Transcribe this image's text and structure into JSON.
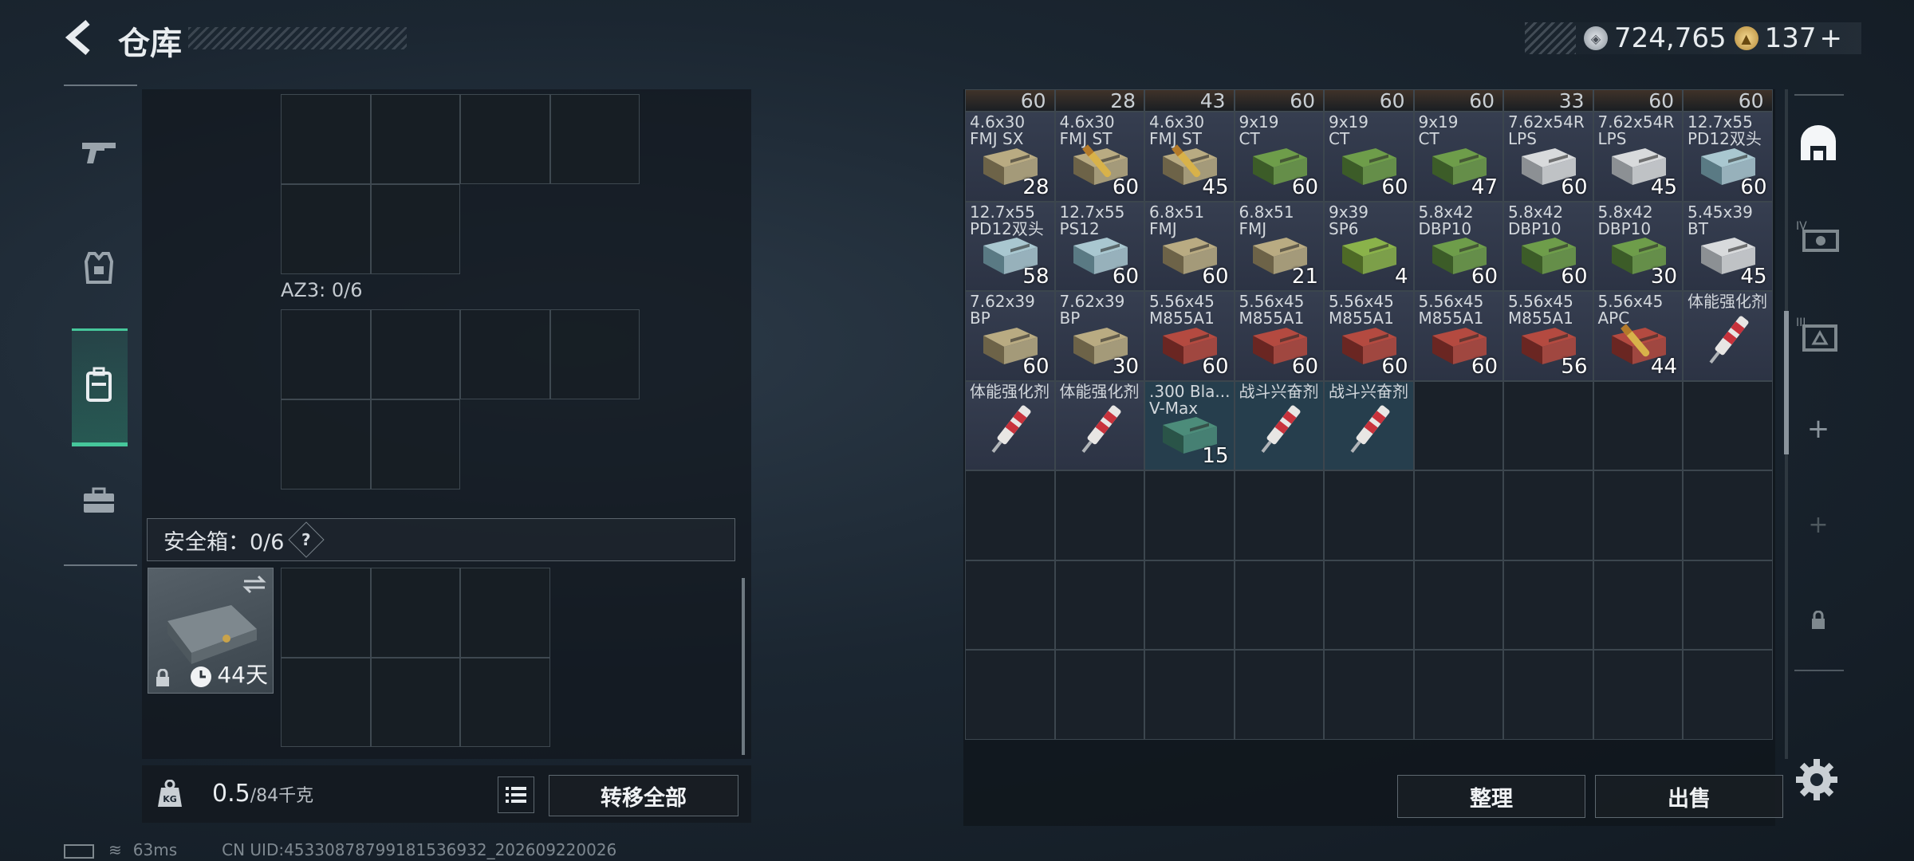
{
  "header": {
    "title": "仓库"
  },
  "currency": {
    "silver": "724,765",
    "gold": "137",
    "gold_add": "+"
  },
  "left": {
    "az_label": "AZ3: 0/6",
    "safebox_label": "安全箱：0/6",
    "help": "?",
    "safebox_timer": "44天",
    "weight_current": "0.5",
    "weight_max": "/84千克",
    "transfer_all": "转移全部"
  },
  "status": {
    "ping": "63ms",
    "uid": "CN UID:4533087879918153693​2_202609220026"
  },
  "stash": {
    "top_counts": [
      "60",
      "28",
      "43",
      "60",
      "60",
      "60",
      "33",
      "60",
      "60"
    ],
    "rows": [
      [
        {
          "l": "4.6x30\nFMJ SX",
          "q": "28",
          "t": "box-tan"
        },
        {
          "l": "4.6x30\nFMJ ST",
          "q": "60",
          "t": "box-tan-gold"
        },
        {
          "l": "4.6x30\nFMJ ST",
          "q": "45",
          "t": "box-tan-gold"
        },
        {
          "l": "9x19\nCT",
          "q": "60",
          "t": "box-green"
        },
        {
          "l": "9x19\nCT",
          "q": "60",
          "t": "box-green"
        },
        {
          "l": "9x19\nCT",
          "q": "47",
          "t": "box-green"
        },
        {
          "l": "7.62x54R\nLPS",
          "q": "60",
          "t": "box-white"
        },
        {
          "l": "7.62x54R\nLPS",
          "q": "45",
          "t": "box-white"
        },
        {
          "l": "12.7x55\nPD12双头",
          "q": "60",
          "t": "box-blue"
        }
      ],
      [
        {
          "l": "12.7x55\nPD12双头",
          "q": "58",
          "t": "box-blue"
        },
        {
          "l": "12.7x55\nPS12",
          "q": "60",
          "t": "box-blue"
        },
        {
          "l": "6.8x51\nFMJ",
          "q": "60",
          "t": "box-tan"
        },
        {
          "l": "6.8x51\nFMJ",
          "q": "21",
          "t": "box-tan"
        },
        {
          "l": "9x39\nSP6",
          "q": "4",
          "t": "box-lime"
        },
        {
          "l": "5.8x42\nDBP10",
          "q": "60",
          "t": "box-green"
        },
        {
          "l": "5.8x42\nDBP10",
          "q": "60",
          "t": "box-green"
        },
        {
          "l": "5.8x42\nDBP10",
          "q": "30",
          "t": "box-green"
        },
        {
          "l": "5.45x39\nBT",
          "q": "45",
          "t": "box-white"
        }
      ],
      [
        {
          "l": "7.62x39\nBP",
          "q": "60",
          "t": "box-tan"
        },
        {
          "l": "7.62x39\nBP",
          "q": "30",
          "t": "box-tan"
        },
        {
          "l": "5.56x45\nM855A1",
          "q": "60",
          "t": "box-red"
        },
        {
          "l": "5.56x45\nM855A1",
          "q": "60",
          "t": "box-red"
        },
        {
          "l": "5.56x45\nM855A1",
          "q": "60",
          "t": "box-red"
        },
        {
          "l": "5.56x45\nM855A1",
          "q": "60",
          "t": "box-red"
        },
        {
          "l": "5.56x45\nM855A1",
          "q": "56",
          "t": "box-red"
        },
        {
          "l": "5.56x45\nAPC",
          "q": "44",
          "t": "box-red-gold"
        },
        {
          "l": "体能强化剂",
          "q": "",
          "t": "syringe"
        }
      ],
      [
        {
          "l": "体能强化剂",
          "q": "",
          "t": "syringe"
        },
        {
          "l": "体能强化剂",
          "q": "",
          "t": "syringe"
        },
        {
          "l": ".300 Bla...\nV-Max",
          "q": "15",
          "t": "box-teal",
          "hl": true
        },
        {
          "l": "战斗兴奋剂",
          "q": "",
          "t": "syringe",
          "hl": true
        },
        {
          "l": "战斗兴奋剂",
          "q": "",
          "t": "syringe",
          "hl": true
        },
        {},
        {},
        {},
        {}
      ]
    ],
    "empty_rows": 3,
    "sort_button": "整理",
    "sell_button": "出售"
  }
}
